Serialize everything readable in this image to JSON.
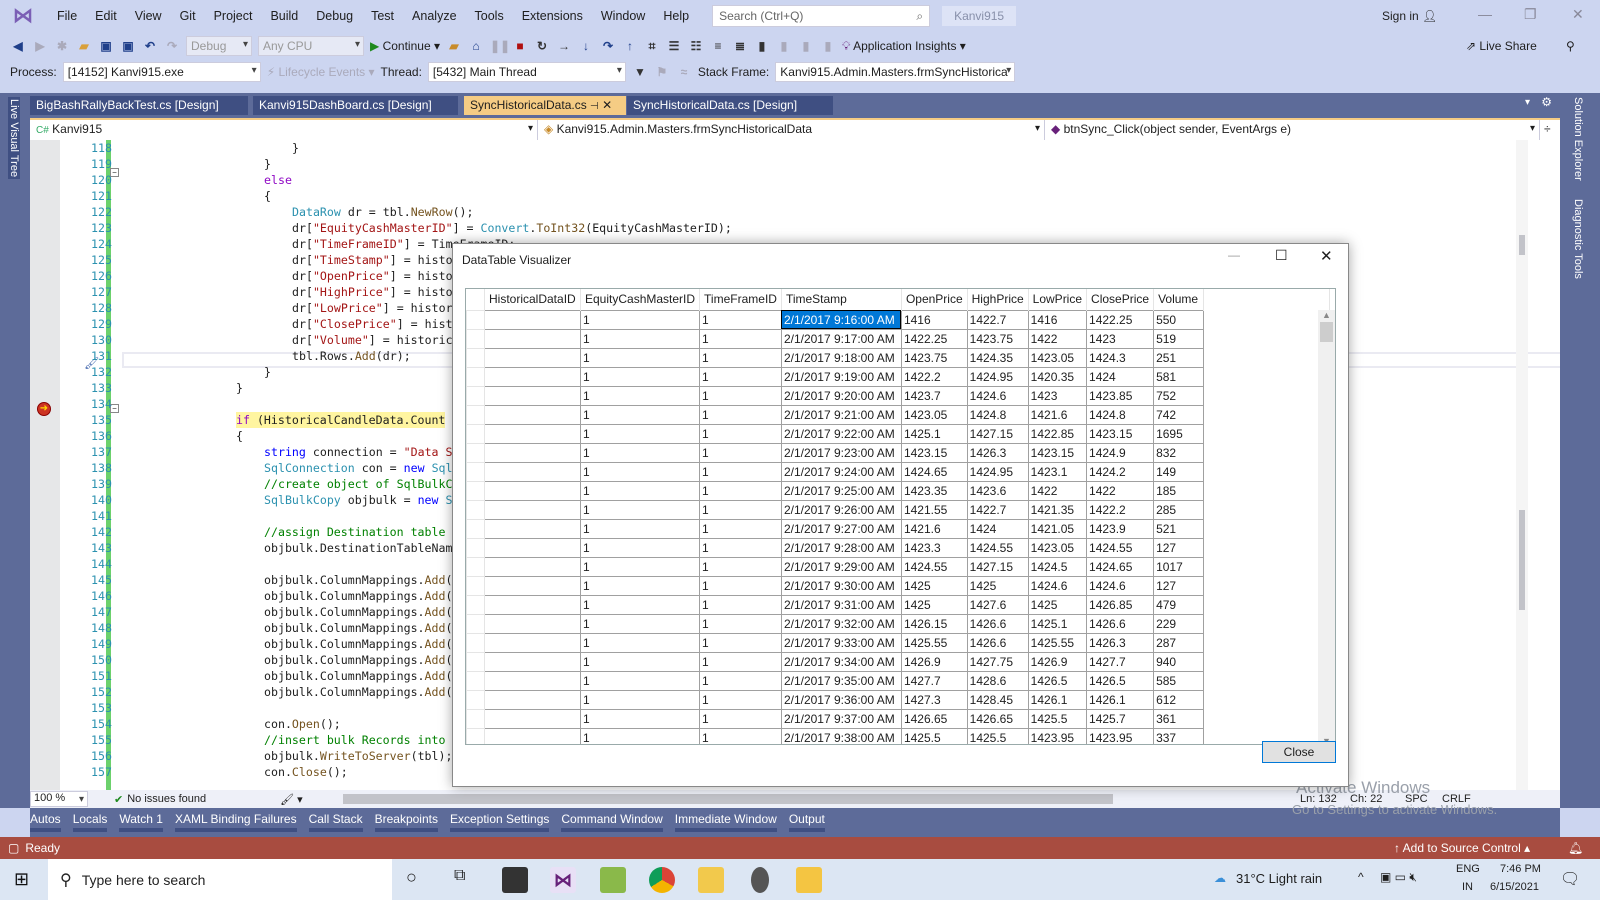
{
  "menu": {
    "items": [
      "File",
      "Edit",
      "View",
      "Git",
      "Project",
      "Build",
      "Debug",
      "Test",
      "Analyze",
      "Tools",
      "Extensions",
      "Window",
      "Help"
    ],
    "search_placeholder": "Search (Ctrl+Q)",
    "solution": "Kanvi915",
    "sign_in": "Sign in"
  },
  "toolbar": {
    "config": "Debug",
    "platform": "Any CPU",
    "continue": "Continue",
    "app_insights": "Application Insights",
    "live_share": "Live Share"
  },
  "debugbar": {
    "process_label": "Process:",
    "process": "[14152] Kanvi915.exe",
    "lifecycle": "Lifecycle Events",
    "thread_label": "Thread:",
    "thread": "[5432] Main Thread",
    "stack_label": "Stack Frame:",
    "stack": "Kanvi915.Admin.Masters.frmSyncHistorica"
  },
  "tabs": [
    {
      "label": "BigBashRallyBackTest.cs [Design]"
    },
    {
      "label": "Kanvi915DashBoard.cs [Design]"
    },
    {
      "label": "SyncHistoricalData.cs",
      "active": true
    },
    {
      "label": "SyncHistoricalData.cs [Design]"
    }
  ],
  "nav": {
    "project": "Kanvi915",
    "class": "Kanvi915.Admin.Masters.frmSyncHistoricalData",
    "member": "btnSync_Click(object sender, EventArgs e)"
  },
  "side_panels": {
    "left": "Live Visual Tree",
    "right1": "Solution Explorer",
    "right2": "Diagnostic Tools"
  },
  "code": [
    {
      "n": "118",
      "i": 24,
      "t": [
        [
          "p",
          "}"
        ]
      ]
    },
    {
      "n": "119",
      "i": 20,
      "t": [
        [
          "p",
          "}"
        ]
      ]
    },
    {
      "n": "120",
      "i": 20,
      "t": [
        [
          "ctrl",
          "else"
        ]
      ]
    },
    {
      "n": "121",
      "i": 20,
      "t": [
        [
          "p",
          "{"
        ]
      ]
    },
    {
      "n": "122",
      "i": 24,
      "t": [
        [
          "type",
          "DataRow"
        ],
        [
          "p",
          " dr = tbl."
        ],
        [
          "meth",
          "NewRow"
        ],
        [
          "p",
          "();"
        ]
      ]
    },
    {
      "n": "123",
      "i": 24,
      "t": [
        [
          "p",
          "dr["
        ],
        [
          "str",
          "\"EquityCashMasterID\""
        ],
        [
          "p",
          "] = "
        ],
        [
          "type",
          "Convert"
        ],
        [
          "p",
          "."
        ],
        [
          "meth",
          "ToInt32"
        ],
        [
          "p",
          "(EquityCashMasterID);"
        ]
      ]
    },
    {
      "n": "124",
      "i": 24,
      "t": [
        [
          "p",
          "dr["
        ],
        [
          "str",
          "\"TimeFrameID\""
        ],
        [
          "p",
          "] = TimeFrameID;"
        ]
      ]
    },
    {
      "n": "125",
      "i": 24,
      "t": [
        [
          "p",
          "dr["
        ],
        [
          "str",
          "\"TimeStamp\""
        ],
        [
          "p",
          "] = histo"
        ]
      ]
    },
    {
      "n": "126",
      "i": 24,
      "t": [
        [
          "p",
          "dr["
        ],
        [
          "str",
          "\"OpenPrice\""
        ],
        [
          "p",
          "] = histo"
        ]
      ]
    },
    {
      "n": "127",
      "i": 24,
      "t": [
        [
          "p",
          "dr["
        ],
        [
          "str",
          "\"HighPrice\""
        ],
        [
          "p",
          "] = histo"
        ]
      ]
    },
    {
      "n": "128",
      "i": 24,
      "t": [
        [
          "p",
          "dr["
        ],
        [
          "str",
          "\"LowPrice\""
        ],
        [
          "p",
          "] = histor"
        ]
      ]
    },
    {
      "n": "129",
      "i": 24,
      "t": [
        [
          "p",
          "dr["
        ],
        [
          "str",
          "\"ClosePrice\""
        ],
        [
          "p",
          "] = hist"
        ]
      ]
    },
    {
      "n": "130",
      "i": 24,
      "t": [
        [
          "p",
          "dr["
        ],
        [
          "str",
          "\"Volume\""
        ],
        [
          "p",
          "] = historic"
        ]
      ]
    },
    {
      "n": "131",
      "i": 24,
      "t": [
        [
          "p",
          "tbl.Rows."
        ],
        [
          "meth",
          "Add"
        ],
        [
          "p",
          "(dr);"
        ]
      ]
    },
    {
      "n": "132",
      "i": 20,
      "t": [
        [
          "p",
          "}"
        ]
      ]
    },
    {
      "n": "133",
      "i": 16,
      "t": [
        [
          "p",
          "}"
        ]
      ]
    },
    {
      "n": "134",
      "i": 0,
      "t": []
    },
    {
      "n": "135",
      "i": 16,
      "hl": true,
      "t": [
        [
          "ctrl",
          "if"
        ],
        [
          "p",
          " (HistoricalCandleData.Count"
        ]
      ]
    },
    {
      "n": "136",
      "i": 16,
      "t": [
        [
          "p",
          "{"
        ]
      ]
    },
    {
      "n": "137",
      "i": 20,
      "t": [
        [
          "kw",
          "string"
        ],
        [
          "p",
          " connection = "
        ],
        [
          "str",
          "\"Data S"
        ]
      ]
    },
    {
      "n": "138",
      "i": 20,
      "t": [
        [
          "type",
          "SqlConnection"
        ],
        [
          "p",
          " con = "
        ],
        [
          "kw",
          "new"
        ],
        [
          "p",
          " "
        ],
        [
          "type",
          "Sql"
        ]
      ]
    },
    {
      "n": "139",
      "i": 20,
      "t": [
        [
          "cmt",
          "//create object of SqlBulkC"
        ]
      ]
    },
    {
      "n": "140",
      "i": 20,
      "t": [
        [
          "type",
          "SqlBulkCopy"
        ],
        [
          "p",
          " objbulk = "
        ],
        [
          "kw",
          "new"
        ],
        [
          "p",
          " "
        ],
        [
          "type",
          "S"
        ]
      ]
    },
    {
      "n": "141",
      "i": 0,
      "t": []
    },
    {
      "n": "142",
      "i": 20,
      "t": [
        [
          "cmt",
          "//assign Destination table"
        ]
      ]
    },
    {
      "n": "143",
      "i": 20,
      "t": [
        [
          "p",
          "objbulk.DestinationTableNam"
        ]
      ]
    },
    {
      "n": "144",
      "i": 0,
      "t": []
    },
    {
      "n": "145",
      "i": 20,
      "t": [
        [
          "p",
          "objbulk.ColumnMappings."
        ],
        [
          "meth",
          "Add"
        ],
        [
          "p",
          "("
        ]
      ]
    },
    {
      "n": "146",
      "i": 20,
      "t": [
        [
          "p",
          "objbulk.ColumnMappings."
        ],
        [
          "meth",
          "Add"
        ],
        [
          "p",
          "("
        ]
      ]
    },
    {
      "n": "147",
      "i": 20,
      "t": [
        [
          "p",
          "objbulk.ColumnMappings."
        ],
        [
          "meth",
          "Add"
        ],
        [
          "p",
          "("
        ]
      ]
    },
    {
      "n": "148",
      "i": 20,
      "t": [
        [
          "p",
          "objbulk.ColumnMappings."
        ],
        [
          "meth",
          "Add"
        ],
        [
          "p",
          "("
        ]
      ]
    },
    {
      "n": "149",
      "i": 20,
      "t": [
        [
          "p",
          "objbulk.ColumnMappings."
        ],
        [
          "meth",
          "Add"
        ],
        [
          "p",
          "("
        ]
      ]
    },
    {
      "n": "150",
      "i": 20,
      "t": [
        [
          "p",
          "objbulk.ColumnMappings."
        ],
        [
          "meth",
          "Add"
        ],
        [
          "p",
          "("
        ]
      ]
    },
    {
      "n": "151",
      "i": 20,
      "t": [
        [
          "p",
          "objbulk.ColumnMappings."
        ],
        [
          "meth",
          "Add"
        ],
        [
          "p",
          "("
        ]
      ]
    },
    {
      "n": "152",
      "i": 20,
      "t": [
        [
          "p",
          "objbulk.ColumnMappings."
        ],
        [
          "meth",
          "Add"
        ],
        [
          "p",
          "("
        ]
      ]
    },
    {
      "n": "153",
      "i": 0,
      "t": []
    },
    {
      "n": "154",
      "i": 20,
      "t": [
        [
          "p",
          "con."
        ],
        [
          "meth",
          "Open"
        ],
        [
          "p",
          "();"
        ]
      ]
    },
    {
      "n": "155",
      "i": 20,
      "t": [
        [
          "cmt",
          "//insert bulk Records into"
        ]
      ]
    },
    {
      "n": "156",
      "i": 20,
      "t": [
        [
          "p",
          "objbulk."
        ],
        [
          "meth",
          "WriteToServer"
        ],
        [
          "p",
          "(tbl);"
        ]
      ]
    },
    {
      "n": "157",
      "i": 20,
      "t": [
        [
          "p",
          "con."
        ],
        [
          "meth",
          "Close"
        ],
        [
          "p",
          "();"
        ]
      ]
    }
  ],
  "dialog": {
    "title": "DataTable Visualizer",
    "close_label": "Close",
    "columns": [
      "HistoricalDataID",
      "EquityCashMasterID",
      "TimeFrameID",
      "TimeStamp",
      "OpenPrice",
      "HighPrice",
      "LowPrice",
      "ClosePrice",
      "Volume"
    ],
    "rows": [
      [
        "",
        "1",
        "1",
        "2/1/2017 9:16:00 AM",
        "1416",
        "1422.7",
        "1416",
        "1422.25",
        "550"
      ],
      [
        "",
        "1",
        "1",
        "2/1/2017 9:17:00 AM",
        "1422.25",
        "1423.75",
        "1422",
        "1423",
        "519"
      ],
      [
        "",
        "1",
        "1",
        "2/1/2017 9:18:00 AM",
        "1423.75",
        "1424.35",
        "1423.05",
        "1424.3",
        "251"
      ],
      [
        "",
        "1",
        "1",
        "2/1/2017 9:19:00 AM",
        "1422.2",
        "1424.95",
        "1420.35",
        "1424",
        "581"
      ],
      [
        "",
        "1",
        "1",
        "2/1/2017 9:20:00 AM",
        "1423.7",
        "1424.6",
        "1423",
        "1423.85",
        "752"
      ],
      [
        "",
        "1",
        "1",
        "2/1/2017 9:21:00 AM",
        "1423.05",
        "1424.8",
        "1421.6",
        "1424.8",
        "742"
      ],
      [
        "",
        "1",
        "1",
        "2/1/2017 9:22:00 AM",
        "1425.1",
        "1427.15",
        "1422.85",
        "1423.15",
        "1695"
      ],
      [
        "",
        "1",
        "1",
        "2/1/2017 9:23:00 AM",
        "1423.15",
        "1426.3",
        "1423.15",
        "1424.9",
        "832"
      ],
      [
        "",
        "1",
        "1",
        "2/1/2017 9:24:00 AM",
        "1424.65",
        "1424.95",
        "1423.1",
        "1424.2",
        "149"
      ],
      [
        "",
        "1",
        "1",
        "2/1/2017 9:25:00 AM",
        "1423.35",
        "1423.6",
        "1422",
        "1422",
        "185"
      ],
      [
        "",
        "1",
        "1",
        "2/1/2017 9:26:00 AM",
        "1421.55",
        "1422.7",
        "1421.35",
        "1422.2",
        "285"
      ],
      [
        "",
        "1",
        "1",
        "2/1/2017 9:27:00 AM",
        "1421.6",
        "1424",
        "1421.05",
        "1423.9",
        "521"
      ],
      [
        "",
        "1",
        "1",
        "2/1/2017 9:28:00 AM",
        "1423.3",
        "1424.55",
        "1423.05",
        "1424.55",
        "127"
      ],
      [
        "",
        "1",
        "1",
        "2/1/2017 9:29:00 AM",
        "1424.55",
        "1427.15",
        "1424.5",
        "1424.65",
        "1017"
      ],
      [
        "",
        "1",
        "1",
        "2/1/2017 9:30:00 AM",
        "1425",
        "1425",
        "1424.6",
        "1424.6",
        "127"
      ],
      [
        "",
        "1",
        "1",
        "2/1/2017 9:31:00 AM",
        "1425",
        "1427.6",
        "1425",
        "1426.85",
        "479"
      ],
      [
        "",
        "1",
        "1",
        "2/1/2017 9:32:00 AM",
        "1426.15",
        "1426.6",
        "1425.1",
        "1426.6",
        "229"
      ],
      [
        "",
        "1",
        "1",
        "2/1/2017 9:33:00 AM",
        "1425.55",
        "1426.6",
        "1425.55",
        "1426.3",
        "287"
      ],
      [
        "",
        "1",
        "1",
        "2/1/2017 9:34:00 AM",
        "1426.9",
        "1427.75",
        "1426.9",
        "1427.7",
        "940"
      ],
      [
        "",
        "1",
        "1",
        "2/1/2017 9:35:00 AM",
        "1427.7",
        "1428.6",
        "1426.5",
        "1426.5",
        "585"
      ],
      [
        "",
        "1",
        "1",
        "2/1/2017 9:36:00 AM",
        "1427.3",
        "1428.45",
        "1426.1",
        "1426.1",
        "612"
      ],
      [
        "",
        "1",
        "1",
        "2/1/2017 9:37:00 AM",
        "1426.65",
        "1426.65",
        "1425.5",
        "1425.7",
        "361"
      ],
      [
        "",
        "1",
        "1",
        "2/1/2017 9:38:00 AM",
        "1425.5",
        "1425.5",
        "1423.95",
        "1423.95",
        "337"
      ]
    ]
  },
  "editor_status": {
    "zoom": "100 %",
    "issues": "No issues found",
    "ln": "Ln: 132",
    "ch": "Ch: 22",
    "spc": "SPC",
    "crlf": "CRLF"
  },
  "tool_tabs": [
    "Autos",
    "Locals",
    "Watch 1",
    "XAML Binding Failures",
    "Call Stack",
    "Breakpoints",
    "Exception Settings",
    "Command Window",
    "Immediate Window",
    "Output"
  ],
  "status": {
    "ready": "Ready",
    "source_control": "Add to Source Control"
  },
  "watermark": {
    "line1": "Activate Windows",
    "line2": "Go to Settings to activate Windows."
  },
  "taskbar": {
    "search_placeholder": "Type here to search",
    "weather": "31°C  Light rain",
    "lang1": "ENG",
    "lang2": "IN",
    "time": "7:46 PM",
    "date": "6/15/2021"
  },
  "colors": {
    "accent_tab": "#f5cc84",
    "status_bar": "#a84c40",
    "tab_well": "#5d6b99",
    "selection": "#0078d7"
  }
}
